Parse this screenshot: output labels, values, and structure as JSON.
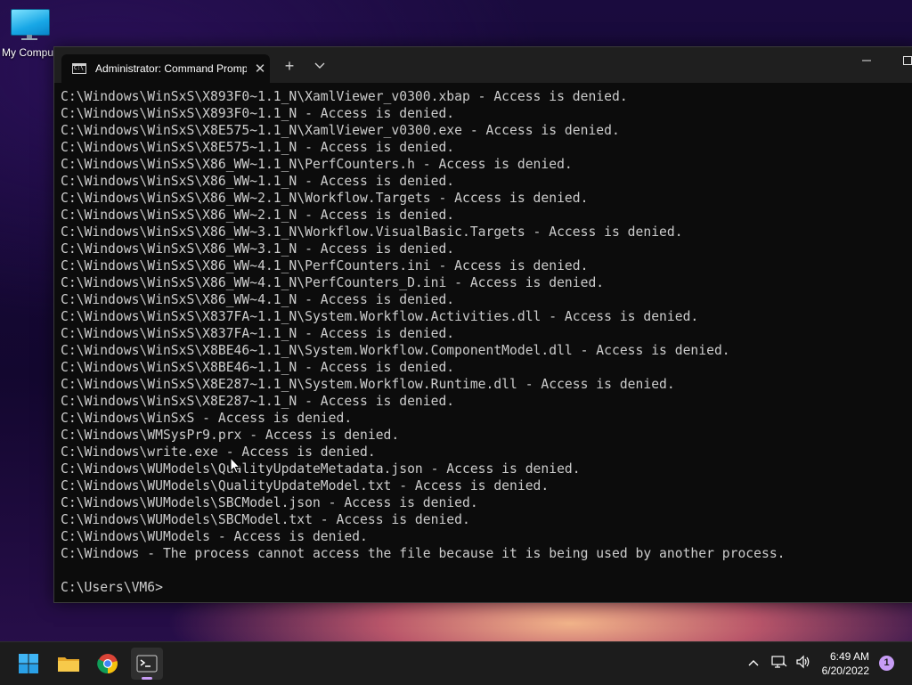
{
  "desktop": {
    "icons": [
      {
        "label": "My Compu",
        "icon": "computer-icon"
      }
    ]
  },
  "window": {
    "tab_title": "Administrator: Command Promp",
    "tab_icon": "cmd-icon",
    "new_tab_glyph": "+",
    "dropdown_glyph": "⌵",
    "minimize_glyph": "—",
    "maximize_glyph": "☐"
  },
  "console": {
    "lines": [
      "C:\\Windows\\WinSxS\\X893F0~1.1_N\\XamlViewer_v0300.xbap - Access is denied.",
      "C:\\Windows\\WinSxS\\X893F0~1.1_N - Access is denied.",
      "C:\\Windows\\WinSxS\\X8E575~1.1_N\\XamlViewer_v0300.exe - Access is denied.",
      "C:\\Windows\\WinSxS\\X8E575~1.1_N - Access is denied.",
      "C:\\Windows\\WinSxS\\X86_WW~1.1_N\\PerfCounters.h - Access is denied.",
      "C:\\Windows\\WinSxS\\X86_WW~1.1_N - Access is denied.",
      "C:\\Windows\\WinSxS\\X86_WW~2.1_N\\Workflow.Targets - Access is denied.",
      "C:\\Windows\\WinSxS\\X86_WW~2.1_N - Access is denied.",
      "C:\\Windows\\WinSxS\\X86_WW~3.1_N\\Workflow.VisualBasic.Targets - Access is denied.",
      "C:\\Windows\\WinSxS\\X86_WW~3.1_N - Access is denied.",
      "C:\\Windows\\WinSxS\\X86_WW~4.1_N\\PerfCounters.ini - Access is denied.",
      "C:\\Windows\\WinSxS\\X86_WW~4.1_N\\PerfCounters_D.ini - Access is denied.",
      "C:\\Windows\\WinSxS\\X86_WW~4.1_N - Access is denied.",
      "C:\\Windows\\WinSxS\\X837FA~1.1_N\\System.Workflow.Activities.dll - Access is denied.",
      "C:\\Windows\\WinSxS\\X837FA~1.1_N - Access is denied.",
      "C:\\Windows\\WinSxS\\X8BE46~1.1_N\\System.Workflow.ComponentModel.dll - Access is denied.",
      "C:\\Windows\\WinSxS\\X8BE46~1.1_N - Access is denied.",
      "C:\\Windows\\WinSxS\\X8E287~1.1_N\\System.Workflow.Runtime.dll - Access is denied.",
      "C:\\Windows\\WinSxS\\X8E287~1.1_N - Access is denied.",
      "C:\\Windows\\WinSxS - Access is denied.",
      "C:\\Windows\\WMSysPr9.prx - Access is denied.",
      "C:\\Windows\\write.exe - Access is denied.",
      "C:\\Windows\\WUModels\\QualityUpdateMetadata.json - Access is denied.",
      "C:\\Windows\\WUModels\\QualityUpdateModel.txt - Access is denied.",
      "C:\\Windows\\WUModels\\SBCModel.json - Access is denied.",
      "C:\\Windows\\WUModels\\SBCModel.txt - Access is denied.",
      "C:\\Windows\\WUModels - Access is denied.",
      "C:\\Windows - The process cannot access the file because it is being used by another process.",
      "",
      "C:\\Users\\VM6>"
    ]
  },
  "taskbar": {
    "apps": [
      {
        "name": "start-button",
        "icon": "windows-logo-icon"
      },
      {
        "name": "file-explorer",
        "icon": "folder-icon"
      },
      {
        "name": "chrome",
        "icon": "chrome-icon"
      },
      {
        "name": "terminal",
        "icon": "terminal-icon",
        "active": true
      }
    ],
    "tray_icons": [
      "chevron-up-icon",
      "network-icon",
      "speaker-icon"
    ],
    "time": "6:49 AM",
    "date": "6/20/2022",
    "notification_count": "1"
  }
}
